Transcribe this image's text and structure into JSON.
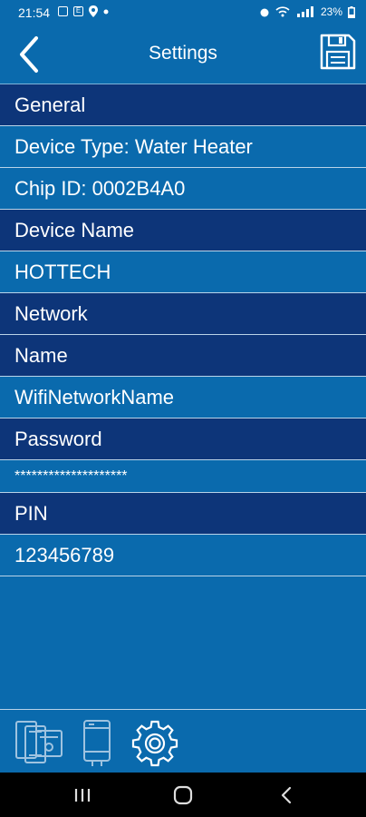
{
  "status_bar": {
    "time": "21:54",
    "battery": "23%",
    "notification_icons": [
      "gallery-notification-icon",
      "e-notification-icon",
      "location-icon",
      "dot-icon"
    ],
    "system_icons": [
      "alarm-icon",
      "wifi-icon",
      "signal-icon",
      "battery-icon"
    ]
  },
  "header": {
    "title": "Settings",
    "back_icon": "chevron-left-icon",
    "save_icon": "floppy-disk-icon"
  },
  "settings": {
    "general_header": "General",
    "device_type": "Device Type: Water Heater",
    "chip_id": "Chip ID: 0002B4A0",
    "device_name_header": "Device Name",
    "device_name_value": "HOTTECH",
    "network_header": "Network",
    "network_name_header": "Name",
    "network_name_value": "WifiNetworkName",
    "password_header": "Password",
    "password_value": "********************",
    "pin_header": "PIN",
    "pin_value": "123456789"
  },
  "bottom_tabs": [
    {
      "icon": "multiple-devices-icon"
    },
    {
      "icon": "water-heater-icon"
    },
    {
      "icon": "gear-icon"
    }
  ],
  "nav_bar": {
    "icons": [
      "recent-apps-icon",
      "home-icon",
      "back-icon"
    ]
  },
  "colors": {
    "background": "#0a6aad",
    "section_header": "#0d3579",
    "divider": "#b9d3e8",
    "nav_bar": "#000000"
  }
}
